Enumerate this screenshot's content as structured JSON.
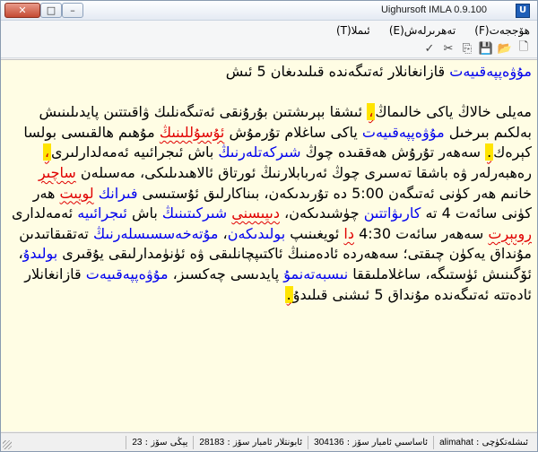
{
  "window": {
    "title": "Uighursoft IMLA 0.9.100",
    "app_icon_glyph": "U",
    "close_glyph": "✕",
    "maximize_glyph": "□",
    "minimize_glyph": "–"
  },
  "menu": [
    {
      "label": "ھۆججەت(F)"
    },
    {
      "label": "تەھرىرلەش(E)"
    },
    {
      "label": "ئىملا(T)"
    }
  ],
  "toolbar": {
    "icons": [
      "new-file-icon",
      "open-folder-icon",
      "save-icon",
      "copy-icon",
      "cut-icon",
      "spellcheck-icon"
    ],
    "glyphs": [
      "🗋",
      "📂",
      "💾",
      "⎘",
      "✂",
      "✓"
    ]
  },
  "document": {
    "heading": [
      {
        "t": "مۇۋەپپەقىيەت",
        "s": "blue"
      },
      {
        "t": " قازانغانلار ئەتىگەندە قىلىدىغان 5 ئىش",
        "s": ""
      }
    ],
    "paragraph": [
      {
        "t": "مەيلى خالاڭ ياكى خالىماڭ",
        "s": ""
      },
      {
        "t": "،",
        "s": "mark"
      },
      {
        "t": " ئىشقا بېرىشتىن بۇرۇنقى ئەتىگەنلىك ۋاقىتتىن پايدىلىنىش بەلكىم بىرخىل ",
        "s": ""
      },
      {
        "t": "مۇۋەپپەقىيەت",
        "s": "blue"
      },
      {
        "t": " ياكى ساغلام تۇرمۇش ",
        "s": ""
      },
      {
        "t": "ئۇسۇللىنىڭ",
        "s": "red"
      },
      {
        "t": " مۇھىم ھالقىسى بولسا كېرەك",
        "s": ""
      },
      {
        "t": ".",
        "s": "mark-plain"
      },
      {
        "t": " سەھەر تۇرۇش ھەققىدە چوڭ ",
        "s": ""
      },
      {
        "t": "شىركەتلەرنىڭ",
        "s": "blue"
      },
      {
        "t": " باش ئىجرائىيە ئەمەلدارلىرى",
        "s": ""
      },
      {
        "t": "،",
        "s": "mark"
      },
      {
        "t": " رەھبەرلەر ۋە باشقا تەسىرى چوڭ ئەربابلارنىڭ ئورتاق ئالاھىدىلىكى، مەسىلەن ",
        "s": ""
      },
      {
        "t": "ساچىر",
        "s": "red"
      },
      {
        "t": " خانىم ھەر كۈنى ئەتىگەن 5:00 دە تۇرىدىكەن، بىناكارلىق ئۇستىسى ",
        "s": ""
      },
      {
        "t": "فىرانك",
        "s": "blue"
      },
      {
        "t": " ",
        "s": ""
      },
      {
        "t": "لويىت",
        "s": "red"
      },
      {
        "t": " ھەر كۈنى سائەت 4 تە ",
        "s": ""
      },
      {
        "t": "كارىۋاتتىن",
        "s": "blue"
      },
      {
        "t": " چۈشىدىكەن، ",
        "s": ""
      },
      {
        "t": "دىيىسنى",
        "s": "red"
      },
      {
        "t": " ",
        "s": ""
      },
      {
        "t": "شىركىتىنىڭ",
        "s": "blue"
      },
      {
        "t": " باش ",
        "s": ""
      },
      {
        "t": "ئىجرائىيە",
        "s": "blue"
      },
      {
        "t": " ئەمەلدارى ",
        "s": ""
      },
      {
        "t": "روبېرت",
        "s": "red"
      },
      {
        "t": " سەھەر سائەت 4:30 ",
        "s": ""
      },
      {
        "t": "دا",
        "s": "red"
      },
      {
        "t": " ئويغىنىپ ",
        "s": ""
      },
      {
        "t": "بولىدىكەن",
        "s": "blue"
      },
      {
        "t": "، ",
        "s": ""
      },
      {
        "t": "مۇتەخەسسىسلەرنىڭ",
        "s": "blue"
      },
      {
        "t": " تەتقىقاتىدىن مۇنداق يەكۈن چىقتى؛ سەھەردە ئادەمنىڭ ئاكتىپچانلىقى ۋە ئۈنۈمدارلىقى يۇقىرى ",
        "s": ""
      },
      {
        "t": "بولىدۇ",
        "s": "blue"
      },
      {
        "t": "، ئۆگىنىش ئۈستىگە، ساغلاملىققا ",
        "s": ""
      },
      {
        "t": "نىسبەتەنمۇ",
        "s": "blue"
      },
      {
        "t": " پايدىسى چەكسىز، ",
        "s": ""
      },
      {
        "t": "مۇۋەپپەقىيەت",
        "s": "blue"
      },
      {
        "t": " قازانغانلار ئادەتتە ئەتىگەندە مۇنداق 5 ئىشنى قىلىدۇ",
        "s": ""
      },
      {
        "t": ".",
        "s": "mark-plain"
      }
    ]
  },
  "status": {
    "state": {
      "label": "ئىشلەتكۈچى",
      "value": "alimahat"
    },
    "total_words": {
      "label": "ئاساسىي ئامبار سۆز",
      "value": "304136"
    },
    "typed_words": {
      "label": "ئابونتلار ئامبار سۆز",
      "value": "28183"
    },
    "new_words": {
      "label": "يېڭى سۆز",
      "value": "23"
    }
  }
}
